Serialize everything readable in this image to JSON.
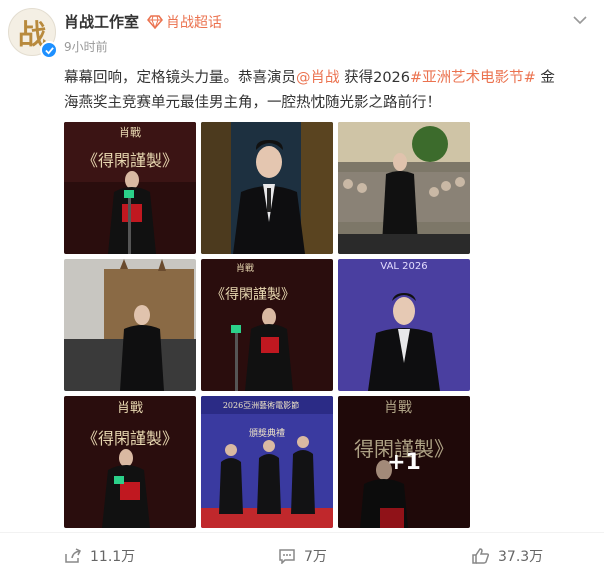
{
  "post": {
    "author": "肖战工作室",
    "super_topic": "肖战超话",
    "time": "9小时前",
    "text_parts": {
      "p1": "幕幕回响，定格镜头力量。恭喜演员",
      "mention": "@肖战",
      "p2": " 获得2026",
      "hashtag": "#亚洲艺术电影节#",
      "p3": " 金海燕奖主竞赛单元最佳男主角，一腔热忱随光影之路前行！"
    },
    "avatar_glyph": "战",
    "more_images": "+1"
  },
  "footer": {
    "share_count": "11.1万",
    "comment_count": "7万",
    "like_count": "37.3万"
  },
  "colors": {
    "accent": "#eb7350",
    "verified": "#1e90ff"
  }
}
